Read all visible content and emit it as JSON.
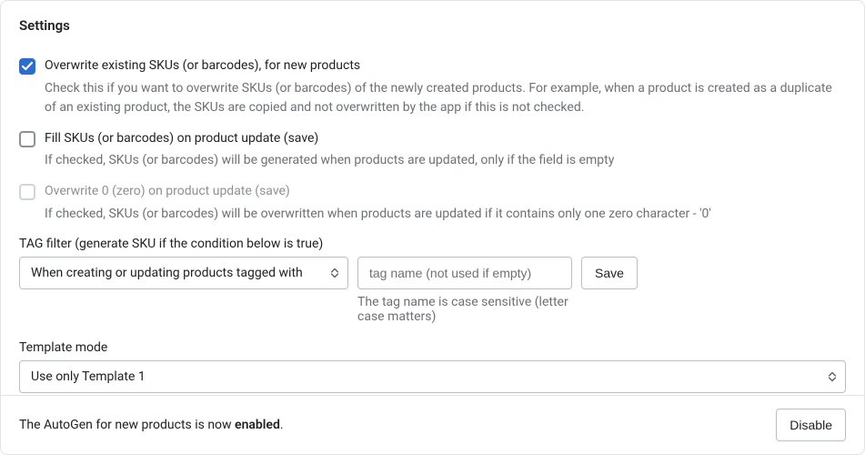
{
  "title": "Settings",
  "options": {
    "overwrite_new": {
      "checked": true,
      "label": "Overwrite existing SKUs (or barcodes), for new products",
      "desc": "Check this if you want to overwrite SKUs (or barcodes) of the newly created products. For example, when a product is created as a duplicate of an existing product, the SKUs are copied and not overwritten by the app if this is not checked."
    },
    "fill_on_update": {
      "checked": false,
      "label": "Fill SKUs (or barcodes) on product update (save)",
      "desc": "If checked, SKUs (or barcodes) will be generated when products are updated, only if the field is empty"
    },
    "overwrite_zero": {
      "checked": false,
      "disabled": true,
      "label": "Overwrite 0 (zero) on product update (save)",
      "desc": "If checked, SKUs (or barcodes) will be overwritten when products are updated if it contains only one zero character - '0'"
    }
  },
  "tag_filter": {
    "label": "TAG filter (generate SKU if the condition below is true)",
    "mode_selected": "When creating or updating products tagged with",
    "input_placeholder": "tag name (not used if empty)",
    "input_value": "",
    "save_label": "Save",
    "hint": "The tag name is case sensitive (letter case matters)"
  },
  "template_mode": {
    "label": "Template mode",
    "selected": "Use only Template 1"
  },
  "footer": {
    "status_prefix": "The AutoGen for new products is now ",
    "status_state": "enabled",
    "status_suffix": ".",
    "disable_label": "Disable"
  }
}
